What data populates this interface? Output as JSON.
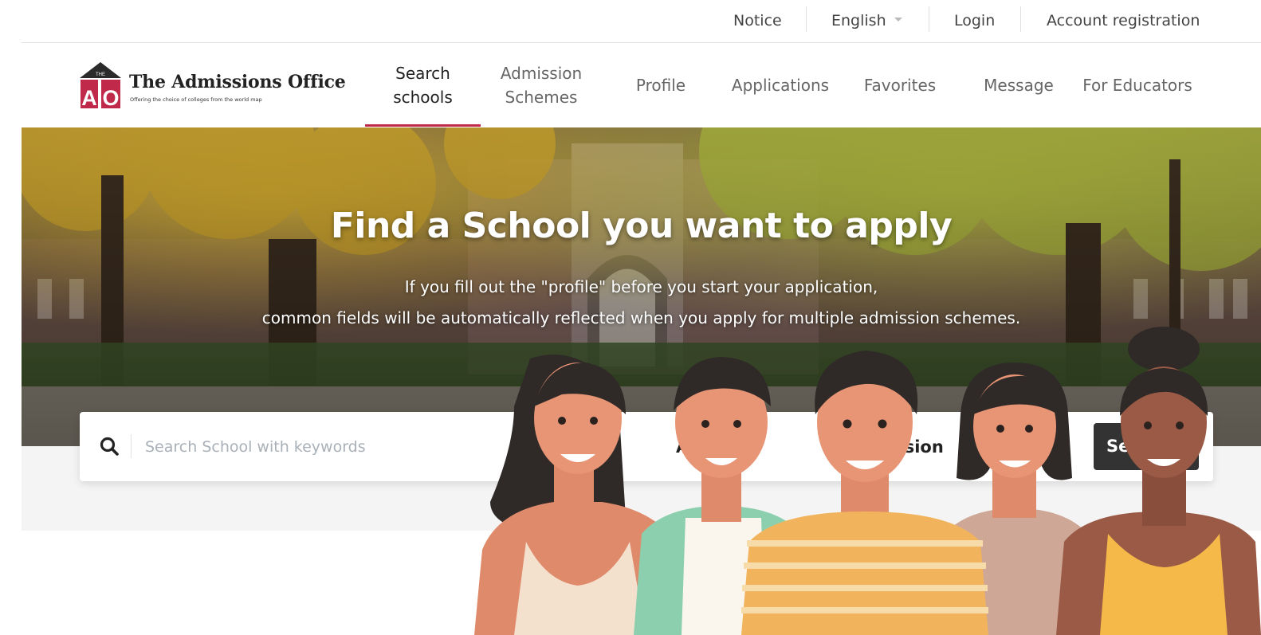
{
  "utility_nav": {
    "notice": "Notice",
    "language": "English",
    "login": "Login",
    "account_registration": "Account registration"
  },
  "brand": {
    "name": "The Admissions Office",
    "tagline": "Offering the choice of colleges from the world map",
    "logo_mark": "AO",
    "logo_roof_text": "THE",
    "accent_color": "#c0294a"
  },
  "main_nav": {
    "items": [
      {
        "line1": "Search",
        "line2": "schools",
        "active": true
      },
      {
        "line1": "Admission",
        "line2": "Schemes",
        "active": false
      },
      {
        "line1": "Profile",
        "line2": "",
        "active": false
      },
      {
        "line1": "Applications",
        "line2": "",
        "active": false
      },
      {
        "line1": "Favorites",
        "line2": "",
        "active": false
      },
      {
        "line1": "Message",
        "line2": "",
        "active": false
      },
      {
        "line1": "For Educators",
        "line2": "",
        "active": false
      }
    ]
  },
  "hero": {
    "title": "Find a School you want to apply",
    "subtitle_line1": "If you fill out the \"profile\" before you start your application,",
    "subtitle_line2": "common fields will be automatically reflected when you apply for multiple admission schemes."
  },
  "search": {
    "icon": "search-icon",
    "placeholder": "Search School with keywords",
    "value": "",
    "filter_area_visible": "A      is",
    "filter_scheme_visible": "ission",
    "button_visible": "Se"
  },
  "colors": {
    "search_button": "#333333",
    "band": "#f4f4f4"
  }
}
